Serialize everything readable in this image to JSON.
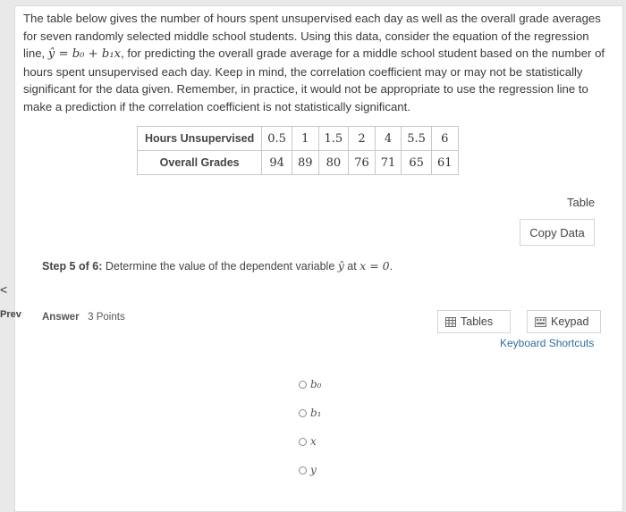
{
  "intro": {
    "p1": "The table below gives the number of hours spent unsupervised each day as well as the overall grade averages for seven randomly selected middle school students. Using this data, consider the equation of the regression line, ",
    "eq": "ŷ = b₀ + b₁x",
    "p2": ", for predicting the overall grade average for a middle school student based on the number of hours spent unsupervised each day. Keep in mind, the correlation coefficient may or may not be statistically significant for the data given. Remember, in practice, it would not be appropriate to use the regression line to make a prediction if the correlation coefficient is not statistically significant."
  },
  "table": {
    "row1_label": "Hours Unsupervised",
    "row1": [
      "0.5",
      "1",
      "1.5",
      "2",
      "4",
      "5.5",
      "6"
    ],
    "row2_label": "Overall Grades",
    "row2": [
      "94",
      "89",
      "80",
      "76",
      "71",
      "65",
      "61"
    ]
  },
  "side": {
    "table_link": "Table",
    "copy_data": "Copy Data"
  },
  "step": {
    "label": "Step 5 of 6:",
    "text_pre": " Determine the value of the dependent variable ",
    "yhat": "ŷ",
    "text_mid": " at ",
    "cond": "x = 0",
    "text_end": "."
  },
  "nav": {
    "prev_arrow": "<",
    "prev_label": "Prev"
  },
  "answer": {
    "label": "Answer",
    "points": "3 Points"
  },
  "tools": {
    "tables": "Tables",
    "keypad": "Keypad",
    "shortcuts": "Keyboard Shortcuts"
  },
  "options": [
    {
      "label": "b₀"
    },
    {
      "label": "b₁"
    },
    {
      "label": "x"
    },
    {
      "label": "y"
    }
  ]
}
